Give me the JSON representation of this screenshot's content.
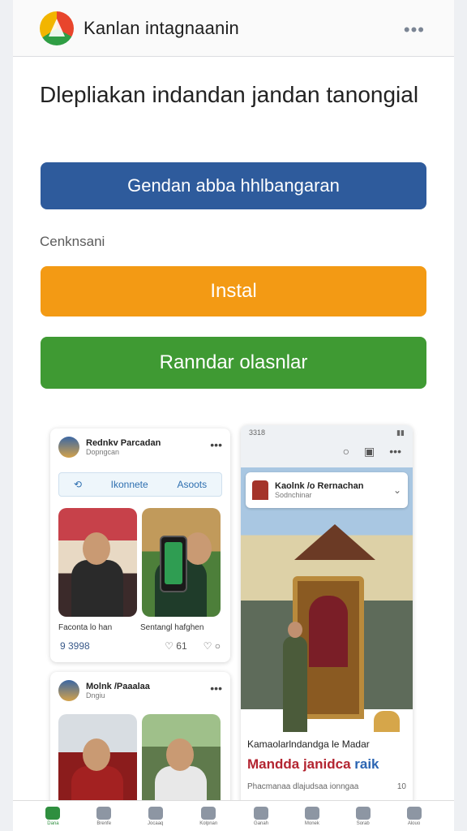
{
  "header": {
    "app_title": "Kanlan intagnaanin",
    "more_icon": "more-dots-icon"
  },
  "headline": "Dlepliakan indandan jandan tanongial",
  "buttons": {
    "primary": "Gendan abba hhlbangaran",
    "install": "Instal",
    "secondary": "Ranndar olasnlar"
  },
  "caption": "Cenknsani",
  "colors": {
    "blue": "#2e5b9c",
    "orange": "#f39a14",
    "green": "#3f9a33"
  },
  "card_a": {
    "name": "Rednkv Parcadan",
    "subtitle": "Dopngcan",
    "pill_left": "Ikonnete",
    "pill_right": "Asoots",
    "captions": [
      "Faconta lo han",
      "Sentangl hafghen"
    ],
    "stat_left": "9 3998",
    "stat_right": "61"
  },
  "card_b": {
    "name": "Molnk /Paaalaa",
    "subtitle": "Dngiu"
  },
  "card_c": {
    "status_time": "3318",
    "inner_name": "Kaolnk /o Rernachan",
    "inner_sub": "Sodnchinar",
    "text_line1": "Kamaolarlndandga le Madar",
    "text_line2": "Mandda janidca",
    "text_line2_accent": "raik",
    "text_line3": "Phacmanaa dlajudsaa ionngaa",
    "text_line3_right": "10"
  },
  "bottom_nav": [
    "Dana",
    "Brenfe",
    "Jocaaq",
    "Kolpnan",
    "Ganah",
    "Monek",
    "Sorab",
    "Alouo"
  ]
}
